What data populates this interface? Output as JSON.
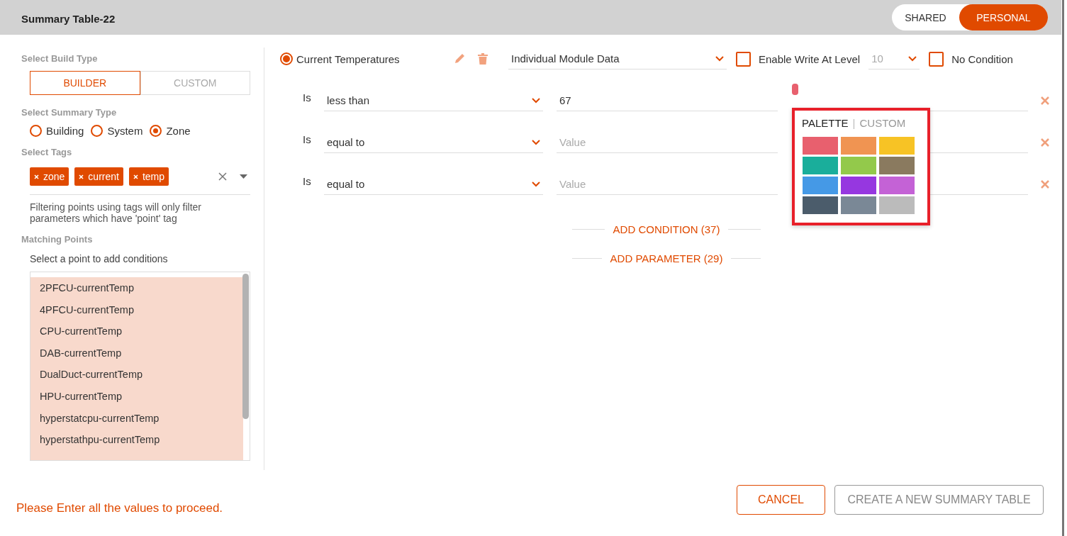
{
  "dialog": {
    "title": "Summary Table-22"
  },
  "visibility_toggle": [
    {
      "label": "SHARED",
      "selected": false
    },
    {
      "label": "PERSONAL",
      "selected": true
    }
  ],
  "build_type": {
    "label": "Select Build Type",
    "options": [
      {
        "label": "BUILDER",
        "selected": true
      },
      {
        "label": "CUSTOM",
        "selected": false
      }
    ]
  },
  "summary_type": {
    "label": "Select Summary Type",
    "options": [
      {
        "label": "Building",
        "selected": false
      },
      {
        "label": "System",
        "selected": false
      },
      {
        "label": "Zone",
        "selected": true
      }
    ]
  },
  "tags": {
    "label": "Select Tags",
    "items": [
      "zone",
      "current",
      "temp"
    ],
    "hint": "Filtering points using tags will only filter parameters which have 'point' tag"
  },
  "matching_points": {
    "label": "Matching Points",
    "hint": "Select a point to add conditions",
    "items": [
      "2PFCU-currentTemp",
      "4PFCU-currentTemp",
      "CPU-currentTemp",
      "DAB-currentTemp",
      "DualDuct-currentTemp",
      "HPU-currentTemp",
      "hyperstatcpu-currentTemp",
      "hyperstathpu-currentTemp"
    ]
  },
  "parameter": {
    "name": "Current Temperatures",
    "selected": true,
    "data_source": "Individual Module Data",
    "enable_write": {
      "label": "Enable Write At Level",
      "checked": false,
      "level": "10"
    },
    "no_condition": {
      "label": "No Condition",
      "checked": false
    }
  },
  "conditions": [
    {
      "prefix": "Is",
      "operator": "less than",
      "value": "67",
      "color": "#e8606e"
    },
    {
      "prefix": "Is",
      "operator": "equal to",
      "placeholder": "Value"
    },
    {
      "prefix": "Is",
      "operator": "equal to",
      "placeholder": "Value"
    }
  ],
  "add_condition": "ADD CONDITION (37)",
  "add_parameter": "ADD PARAMETER (29)",
  "color_picker": {
    "tabs": [
      {
        "label": "PALETTE",
        "selected": true
      },
      {
        "label": "CUSTOM",
        "selected": false
      }
    ],
    "separator": "|",
    "swatches": [
      {
        "color": "#e8606e"
      },
      {
        "color": "#f09452"
      },
      {
        "color": "#f7c325"
      },
      {
        "color": "#1aae9b"
      },
      {
        "color": "#93c94b"
      },
      {
        "color": "#8a7a5f"
      },
      {
        "color": "#4599e6"
      },
      {
        "color": "#9637e0"
      },
      {
        "color": "#c462d6"
      },
      {
        "color": "#4b5c6b"
      },
      {
        "color": "#7a8896"
      },
      {
        "color": "#bbbbbb"
      }
    ]
  },
  "error": "Please Enter all the values to proceed.",
  "buttons": [
    {
      "label": "CANCEL",
      "kind": "primary"
    },
    {
      "label": "CREATE A NEW SUMMARY TABLE",
      "kind": "disabled"
    }
  ]
}
